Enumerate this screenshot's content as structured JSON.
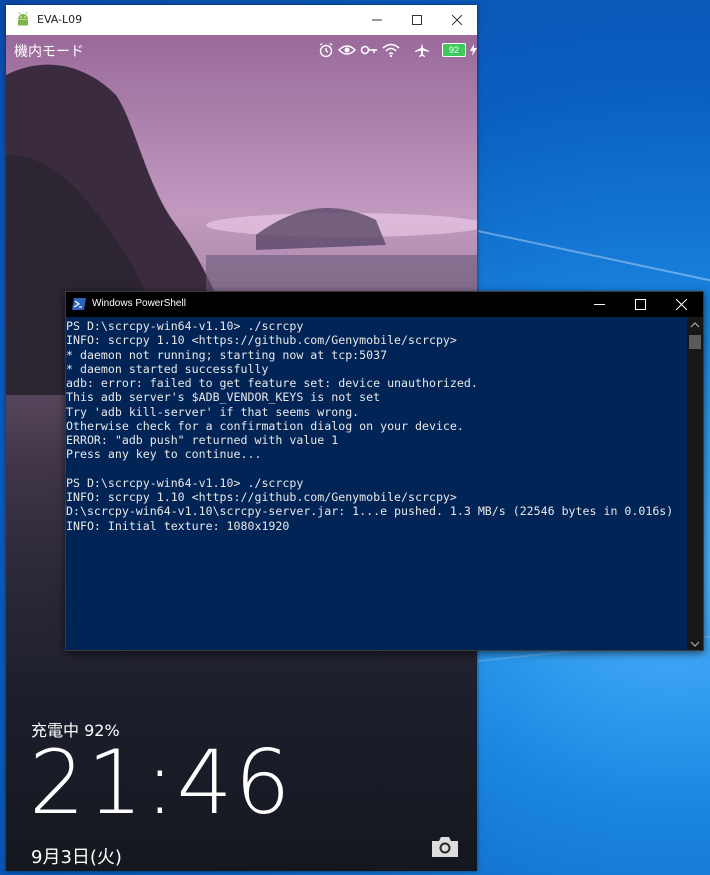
{
  "phone_window": {
    "title": "EVA-L09",
    "lockscreen": {
      "status_text": "機内モード",
      "battery_level": "92",
      "charging_text": "充電中 92%",
      "time": "21:46",
      "date": "9月3日(火)"
    }
  },
  "powershell": {
    "title": "Windows PowerShell",
    "lines": [
      "PS D:\\scrcpy-win64-v1.10> ./scrcpy",
      "INFO: scrcpy 1.10 <https://github.com/Genymobile/scrcpy>",
      "* daemon not running; starting now at tcp:5037",
      "* daemon started successfully",
      "adb: error: failed to get feature set: device unauthorized.",
      "This adb server's $ADB_VENDOR_KEYS is not set",
      "Try 'adb kill-server' if that seems wrong.",
      "Otherwise check for a confirmation dialog on your device.",
      "ERROR: \"adb push\" returned with value 1",
      "Press any key to continue...",
      "",
      "PS D:\\scrcpy-win64-v1.10> ./scrcpy",
      "INFO: scrcpy 1.10 <https://github.com/Genymobile/scrcpy>",
      "D:\\scrcpy-win64-v1.10\\scrcpy-server.jar: 1...e pushed. 1.3 MB/s (22546 bytes in 0.016s)",
      "INFO: Initial texture: 1080x1920"
    ]
  },
  "colors": {
    "powershell_bg": "#012456",
    "battery_green": "#3dc95b",
    "desktop_blue": "#0a5fc0"
  },
  "icons": [
    "android-icon",
    "alarm-icon",
    "eye-icon",
    "key-icon",
    "wifi-icon",
    "airplane-icon",
    "battery-icon",
    "charging-bolt-icon",
    "camera-icon",
    "powershell-icon",
    "minimize-icon",
    "maximize-icon",
    "close-icon"
  ]
}
